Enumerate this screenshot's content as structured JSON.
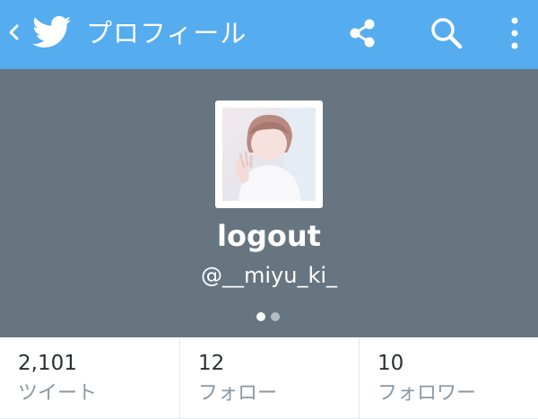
{
  "appbar": {
    "back_icon": "chevron-left-icon",
    "logo_icon": "twitter-bird-icon",
    "title": "プロフィール",
    "actions": [
      {
        "icon": "share-icon"
      },
      {
        "icon": "search-icon"
      },
      {
        "icon": "more-vertical-icon"
      }
    ]
  },
  "profile": {
    "display_name": "logout",
    "handle": "@__miyu_ki_",
    "pager_page": 1,
    "pager_total": 2
  },
  "stats": [
    {
      "count": "2,101",
      "label": "ツイート"
    },
    {
      "count": "12",
      "label": "フォロー"
    },
    {
      "count": "10",
      "label": "フォロワー"
    }
  ],
  "colors": {
    "appbar": "#55acee",
    "hero": "#66757f",
    "stat_label": "#8899a6",
    "stat_count": "#292f33",
    "divider": "#e1e8ed"
  }
}
